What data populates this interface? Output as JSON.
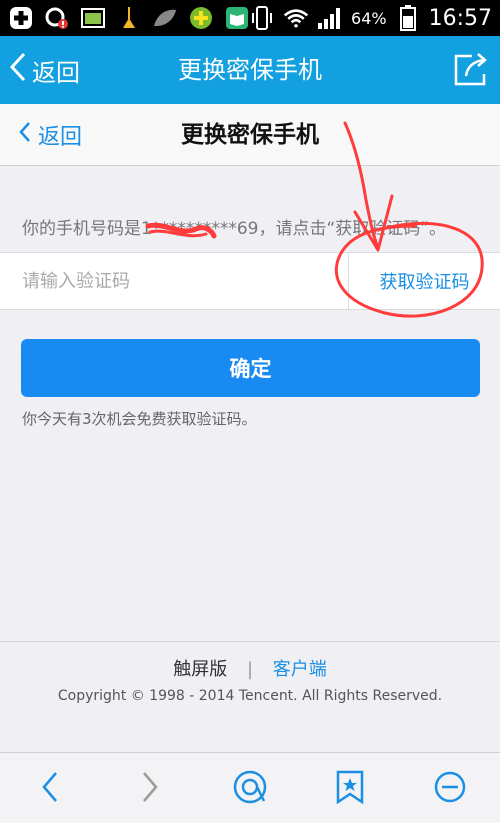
{
  "status_bar": {
    "battery_text": "64%",
    "time": "16:57"
  },
  "app_bar": {
    "back_label": "返回",
    "title": "更换密保手机"
  },
  "nav_bar": {
    "back_label": "返回",
    "title": "更换密保手机"
  },
  "phone_hint": {
    "text": "你的手机号码是1**********69，请点击“获取验证码”。"
  },
  "code_field": {
    "placeholder": "请输入验证码",
    "get_code_label": "获取验证码"
  },
  "confirm_button": {
    "label": "确定"
  },
  "tip": {
    "text": "你今天有3次机会免费获取验证码。"
  },
  "footer": {
    "touch_label": "触屏版",
    "separator": "|",
    "client_label": "客户端",
    "copyright": "Copyright © 1998 - 2014 Tencent. All Rights Reserved."
  },
  "annotation": {
    "color": "#ff3b3b"
  },
  "colors": {
    "app_bar": "#12a0e0",
    "accent": "#1a8af3",
    "link": "#1a8fe3"
  }
}
